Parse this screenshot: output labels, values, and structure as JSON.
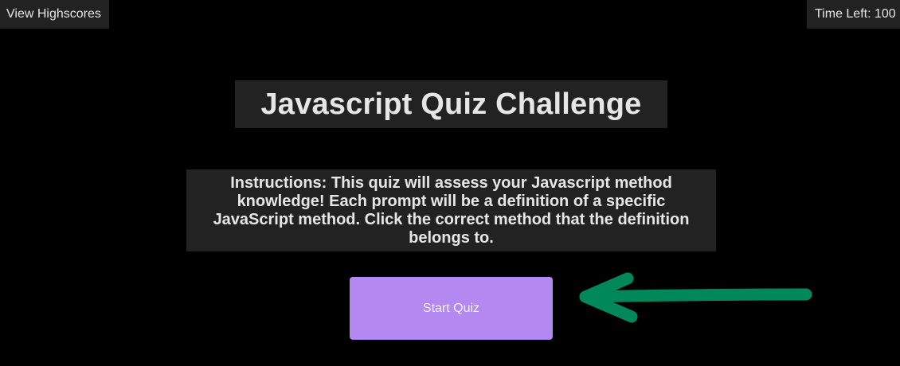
{
  "header": {
    "highscores_label": "View Highscores",
    "timer_label": "Time Left: 100"
  },
  "main": {
    "title": "Javascript Quiz Challenge",
    "instructions": "Instructions: This quiz will assess your Javascript method knowledge! Each prompt will be a definition of a specific JavaScript method. Click the correct method that the definition belongs to.",
    "start_button_label": "Start Quiz"
  },
  "annotation": {
    "icon": "arrow-left-icon",
    "color": "#00875a"
  },
  "colors": {
    "background": "#000000",
    "panel": "#222222",
    "text": "#e6e6e6",
    "button": "#b388f0"
  }
}
